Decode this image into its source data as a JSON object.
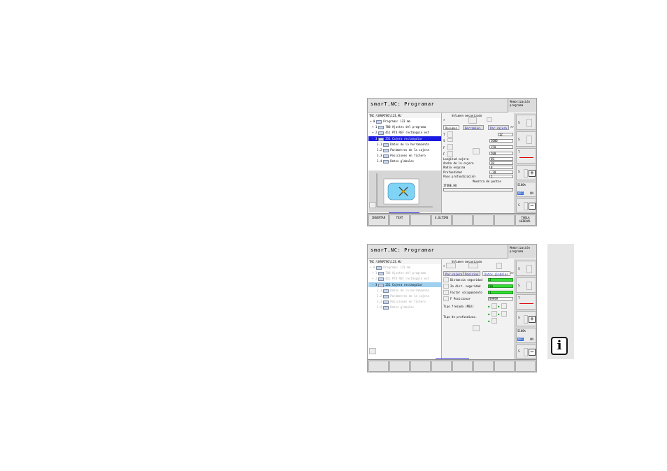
{
  "screen1": {
    "title": "smarT.NC: Programar",
    "mode": [
      "Memorización",
      "programa"
    ],
    "path": "TNC:\\SMARTNC\\123.HU",
    "tree": [
      {
        "num": "0",
        "label": "Programa: 123 mm"
      },
      {
        "num": "1",
        "label": "700 Ajustes del programa"
      },
      {
        "num": "2",
        "label": "411 PTO REF rectángulo ext"
      },
      {
        "num": "3",
        "label": "251 Cajera rectangular"
      },
      {
        "num": "3.1",
        "label": "Datos de la herramienta"
      },
      {
        "num": "3.2",
        "label": "Parámetros de la cajera"
      },
      {
        "num": "3.3",
        "label": "Posiciones en fichero"
      },
      {
        "num": "3.4",
        "label": "Datos globales"
      }
    ],
    "header_label": "Volumen mecanizado",
    "tabs": [
      "Resumen",
      "Herramien.",
      "Par.cajera"
    ],
    "field_values": [
      "12",
      "3000",
      "150",
      "500"
    ],
    "params": [
      {
        "label": "Longitud cajera",
        "value": "60"
      },
      {
        "label": "Ancho de la cajera",
        "value": "20"
      },
      {
        "label": "Radio esquina",
        "value": "0"
      },
      {
        "label": "Profundidad",
        "value": "-20"
      },
      {
        "label": "Paso profundización",
        "value": "5"
      }
    ],
    "pattern_label": "Muestra de puntos",
    "file_label": "ITOBE.HU",
    "softkeys": [
      "INSERTAR",
      "TEXT",
      "",
      "G.ÚLTIMO",
      "",
      "",
      "",
      "TABLA HERRAM."
    ]
  },
  "screen2": {
    "title": "smarT.NC: Programar",
    "mode": [
      "Memorización",
      "programa"
    ],
    "path": "TNC:\\SMARTNC\\123.HU",
    "tree": [
      {
        "num": "0",
        "label": "Programa: 123 mm"
      },
      {
        "num": "1",
        "label": "700 Ajustes del programa"
      },
      {
        "num": "2",
        "label": "411 PTO REF rectángulo ext"
      },
      {
        "num": "3",
        "label": "251 Cajera rectangular"
      },
      {
        "num": "3.1",
        "label": "Datos de la herramienta"
      },
      {
        "num": "3.2",
        "label": "Parámetros de la cajera"
      },
      {
        "num": "3.3",
        "label": "Posiciones en fichero"
      },
      {
        "num": "3.4",
        "label": "Datos globales"
      }
    ],
    "header_label": "Volumen mecanizado",
    "tabs": [
      "Par.cajera",
      "Posicion",
      "Datos globales"
    ],
    "params": [
      {
        "label": "Distancia seguridad",
        "value": "2"
      },
      {
        "label": "2a dist. seguridad",
        "value": "50"
      },
      {
        "label": "Factor solapamiento",
        "value": "1"
      },
      {
        "label": "F Posicionar",
        "value": "99999"
      }
    ],
    "tipo_fresado": "Tipo fresado (M03)",
    "tipo_profundizacion": "Tipo de profundizac."
  },
  "side_keys": [
    "S100%",
    "OFF",
    "ON"
  ],
  "colors": {
    "selection": "#1a1ae0",
    "selection_light": "#9fd0ef",
    "value_bar": "#33dd33",
    "tab_blue": "#2020c0"
  },
  "icons": [
    "info-icon",
    "plus-icon",
    "minus-icon",
    "tool-icon",
    "pocket-icon"
  ]
}
